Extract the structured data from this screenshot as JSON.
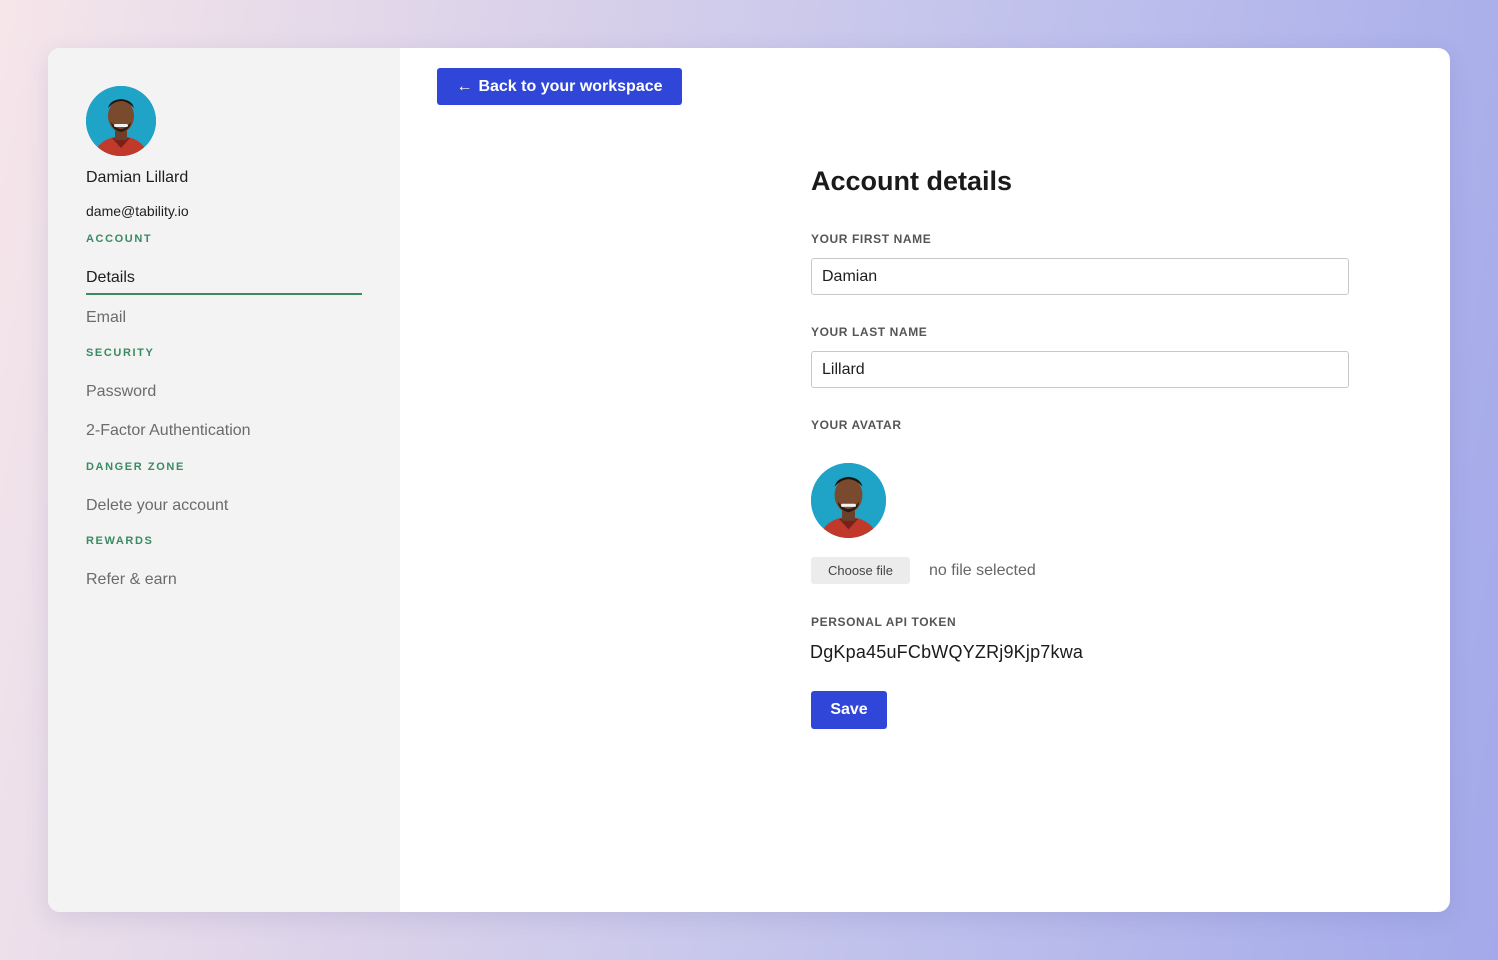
{
  "user": {
    "name": "Damian Lillard",
    "email": "dame@tability.io"
  },
  "sidebar": {
    "sections": [
      {
        "label": "ACCOUNT",
        "items": [
          {
            "label": "Details",
            "active": true
          },
          {
            "label": "Email"
          }
        ]
      },
      {
        "label": "SECURITY",
        "items": [
          {
            "label": "Password"
          },
          {
            "label": "2-Factor Authentication"
          }
        ]
      },
      {
        "label": "DANGER ZONE",
        "items": [
          {
            "label": "Delete your account"
          }
        ]
      },
      {
        "label": "REWARDS",
        "items": [
          {
            "label": "Refer & earn"
          }
        ]
      }
    ]
  },
  "header": {
    "back_button_label": "Back to your workspace",
    "back_icon": "arrow-left-icon"
  },
  "form": {
    "title": "Account details",
    "first_name_label": "YOUR FIRST NAME",
    "first_name_value": "Damian",
    "last_name_label": "YOUR LAST NAME",
    "last_name_value": "Lillard",
    "avatar_label": "YOUR AVATAR",
    "choose_file_label": "Choose file",
    "no_file_text": "no file selected",
    "api_token_label": "PERSONAL API TOKEN",
    "api_token_value": "DgKpa45uFCbWQYZRj9Kjp7kwa",
    "save_label": "Save"
  },
  "colors": {
    "primary": "#3046d8",
    "section_label": "#3a8a62",
    "sidebar_bg": "#f3f3f3",
    "avatar_bg": "#1fa3c6"
  }
}
